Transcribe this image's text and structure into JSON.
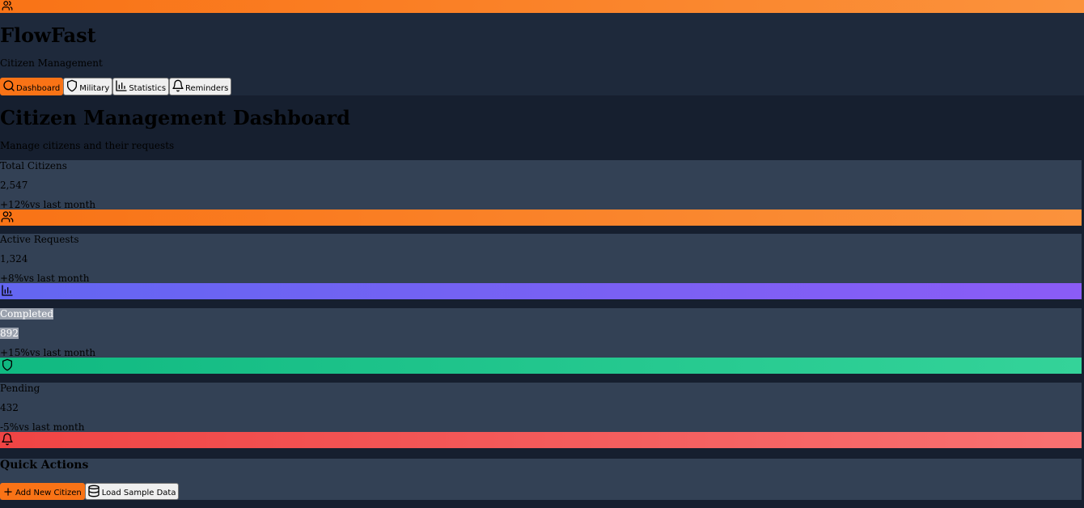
{
  "brand": {
    "title": "FlowFast",
    "subtitle": "Citizen Management",
    "icon": "users-icon"
  },
  "nav": {
    "items": [
      {
        "label": "Dashboard",
        "icon": "search-icon",
        "active": true
      },
      {
        "label": "Military",
        "icon": "shield-icon",
        "active": false
      },
      {
        "label": "Statistics",
        "icon": "bar-chart-icon",
        "active": false
      },
      {
        "label": "Reminders",
        "icon": "bell-icon",
        "active": false
      }
    ]
  },
  "page": {
    "title": "Citizen Management Dashboard",
    "subtitle": "Manage citizens and their requests"
  },
  "stats": [
    {
      "label": "Total Citizens",
      "value": "2,547",
      "change": "+12%",
      "change_suffix": "vs last month",
      "icon": "users-icon",
      "color": "#f97316"
    },
    {
      "label": "Active Requests",
      "value": "1,324",
      "change": "+8%",
      "change_suffix": "vs last month",
      "icon": "bar-chart-icon",
      "color": "#6366f1"
    },
    {
      "label": "Completed",
      "value": "892",
      "change": "+15%",
      "change_suffix": "vs last month",
      "icon": "shield-icon",
      "color": "#10b981"
    },
    {
      "label": "Pending",
      "value": "432",
      "change": "-5%",
      "change_suffix": "vs last month",
      "icon": "bell-icon",
      "color": "#ef4444"
    }
  ],
  "quick_actions": {
    "title": "Quick Actions",
    "buttons": [
      {
        "label": "Add New Citizen",
        "icon": "plus-icon"
      },
      {
        "label": "Load Sample Data",
        "icon": "database-icon"
      }
    ]
  },
  "colors": {
    "accent": "#f97316",
    "background": "#1e293b",
    "card": "#334155"
  }
}
